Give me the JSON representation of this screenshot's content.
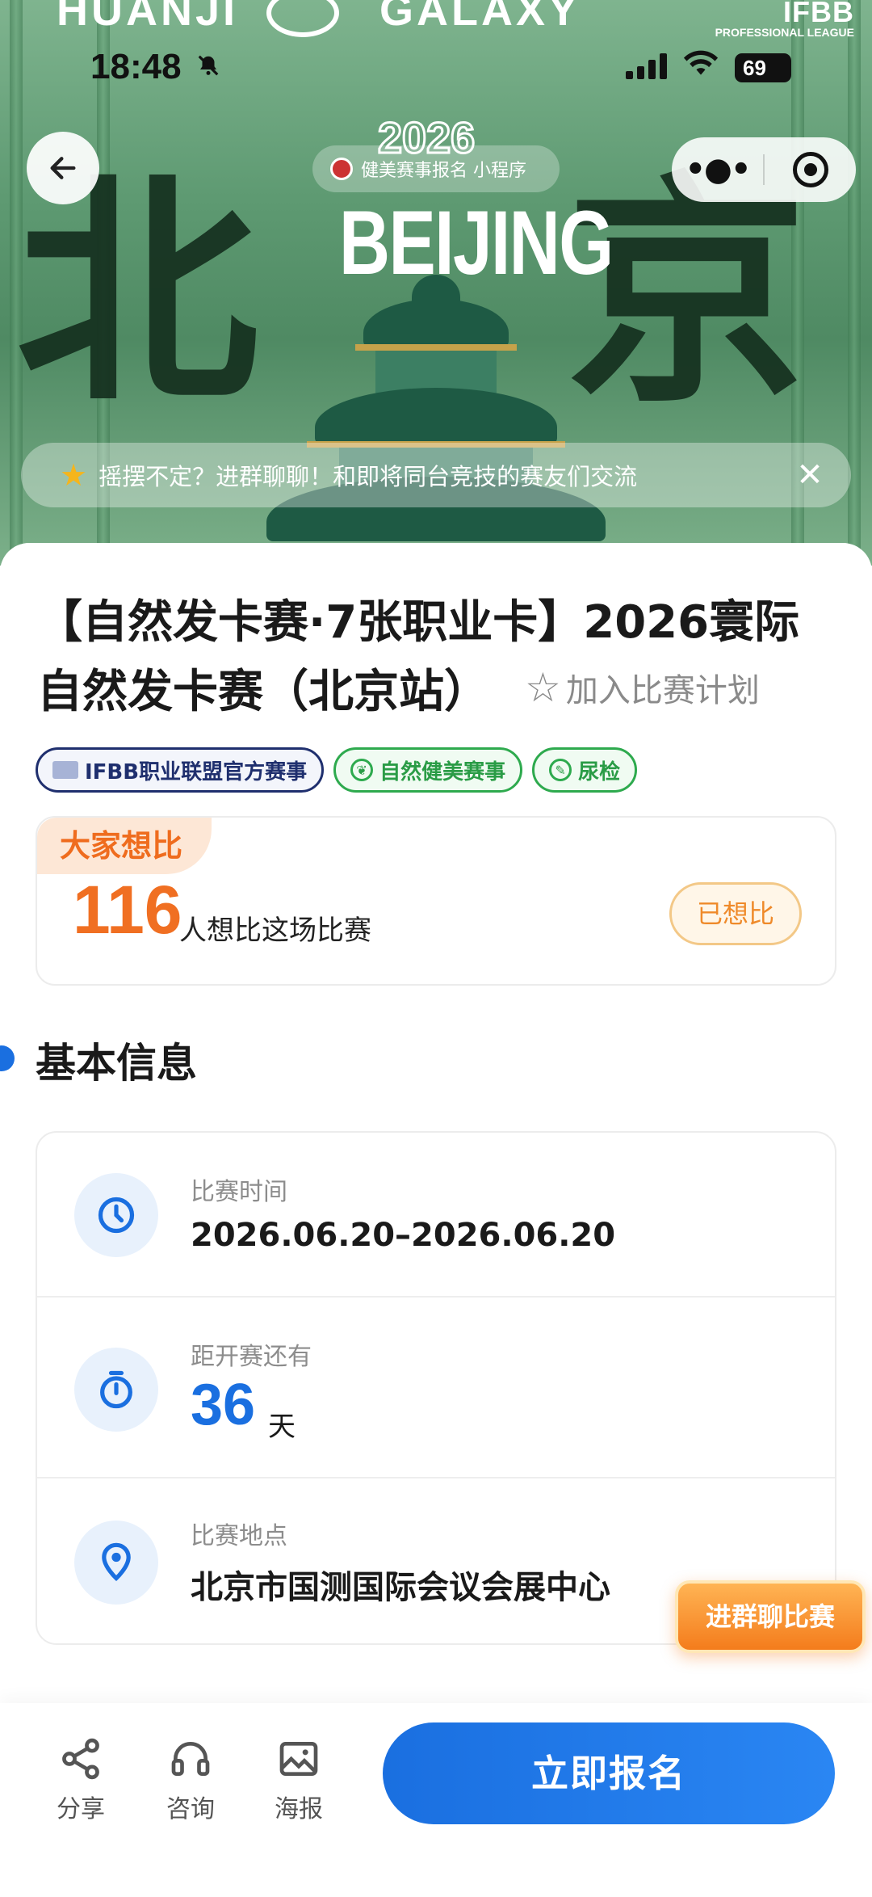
{
  "status_bar": {
    "time": "18:48",
    "battery": "69"
  },
  "hero": {
    "brand_left": "HUANJI",
    "brand_right": "GALAXY",
    "ifbb_line1": "IFBB",
    "ifbb_line2": "PROFESSIONAL LEAGUE",
    "mini_program_label": "健美赛事报名 小程序",
    "year": "2026",
    "city": "BEIJING",
    "brush_chars": [
      "北",
      "京"
    ],
    "notice_text": "摇摆不定？进群聊聊！和即将同台竞技的赛友们交流"
  },
  "competition": {
    "title": "【自然发卡赛·7张职业卡】2026寰际自然发卡赛（北京站）",
    "add_to_plan": "加入比赛计划",
    "tags": [
      {
        "label": "IFBB职业联盟官方赛事"
      },
      {
        "label": "自然健美赛事"
      },
      {
        "label": "尿检"
      }
    ]
  },
  "interest": {
    "tab_label": "大家想比",
    "count": "116",
    "text": "人想比这场比赛",
    "button": "已想比"
  },
  "basic_info": {
    "section_title": "基本信息",
    "time_label": "比赛时间",
    "time_value": "2026.06.20–2026.06.20",
    "countdown_label": "距开赛还有",
    "countdown_days": "36",
    "countdown_unit": "天",
    "venue_label": "比赛地点",
    "venue_value": "北京市国测国际会议会展中心"
  },
  "floating": {
    "join_chat": "进群聊比赛"
  },
  "bottom_bar": {
    "share": "分享",
    "consult": "咨询",
    "poster": "海报",
    "register": "立即报名"
  },
  "colors": {
    "primary_blue": "#1a6fe0",
    "orange": "#f06f22",
    "green_tag": "#2eaa4e",
    "navy_tag": "#1f2f6e",
    "hero_green": "#5e9a72"
  },
  "icons": [
    "back-arrow-icon",
    "more-dots-icon",
    "close-circle-icon",
    "star-icon",
    "close-icon",
    "clock-icon",
    "timer-icon",
    "location-pin-icon",
    "share-icon",
    "headset-icon",
    "image-icon",
    "bell-slash-icon",
    "wifi-icon",
    "signal-icon",
    "battery-icon"
  ]
}
